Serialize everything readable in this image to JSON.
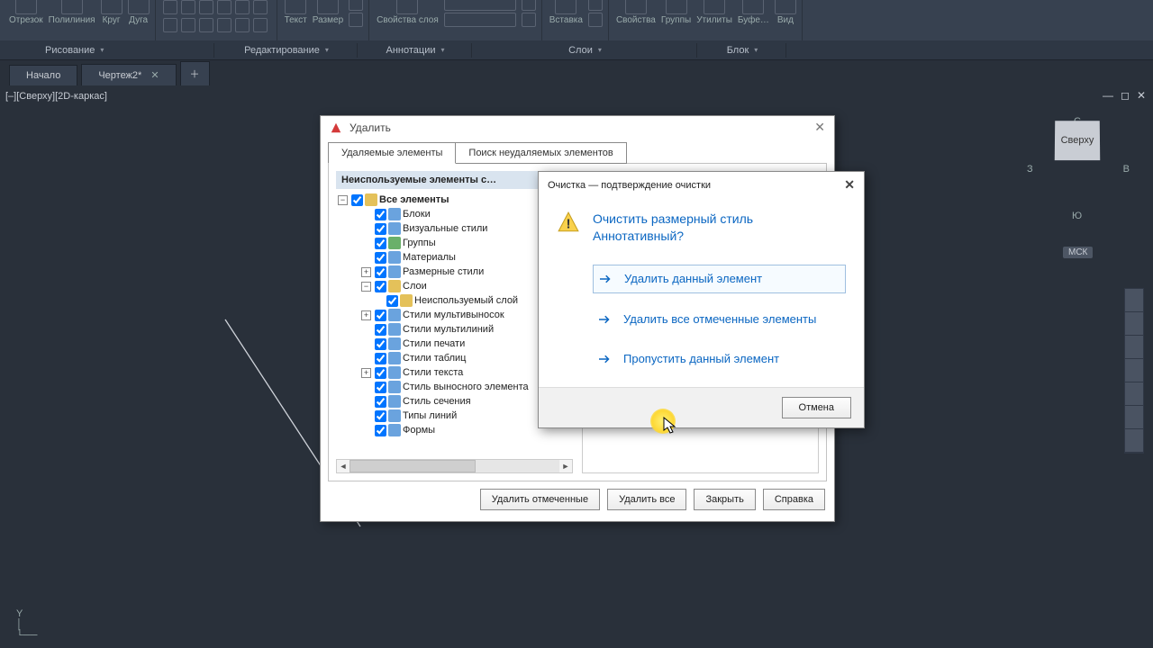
{
  "ribbon": {
    "items": [
      "Отрезок",
      "Полилиния",
      "Круг",
      "Дуга",
      "Текст",
      "Размер",
      "Свойства слоя",
      "Вставка",
      "Свойства",
      "Группы",
      "Утилиты",
      "Буфе…",
      "Вид"
    ],
    "cats": [
      "Рисование",
      "Редактирование",
      "Аннотации",
      "Слои",
      "Блок"
    ]
  },
  "tabs": {
    "t1": "Начало",
    "t2": "Чертеж2*"
  },
  "viewport": {
    "label": "[–][Сверху][2D-каркас]"
  },
  "cube": {
    "face": "Сверху",
    "n": "С",
    "e": "В",
    "w": "З",
    "s": "Ю",
    "tag": "МСК"
  },
  "dlg": {
    "title": "Удалить",
    "tab1": "Удаляемые элементы",
    "tab2": "Поиск неудаляемых элементов",
    "leftHead": "Неиспользуемые элементы с…",
    "tree": {
      "root": "Все элементы",
      "i": [
        "Блоки",
        "Визуальные стили",
        "Группы",
        "Материалы",
        "Размерные стили",
        "Слои",
        "Неиспользуемый слой",
        "Стили мультивыносок",
        "Стили мультилиний",
        "Стили печати",
        "Стили таблиц",
        "Стили текста",
        "Стиль выносного элемента",
        "Стиль сечения",
        "Типы линий",
        "Формы"
      ]
    },
    "btns": {
      "b1": "Удалить отмеченные",
      "b2": "Удалить все",
      "b3": "Закрыть",
      "b4": "Справка"
    }
  },
  "cdlg": {
    "title": "Очистка — подтверждение очистки",
    "msg": "Очистить размерный стиль Аннотативный?",
    "a1": "Удалить данный элемент",
    "a2": "Удалить все отмеченные элементы",
    "a3": "Пропустить данный элемент",
    "cancel": "Отмена"
  },
  "ucs": "Y"
}
